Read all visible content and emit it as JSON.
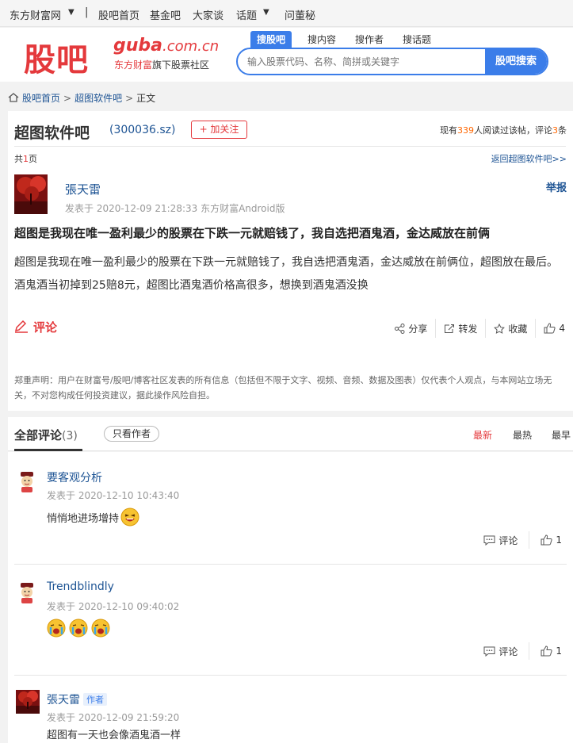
{
  "topbar": {
    "site": "东方财富网",
    "links": [
      "股吧首页",
      "基金吧",
      "大家谈",
      "话题",
      "问董秘"
    ]
  },
  "header": {
    "logo_cn": "股吧",
    "logo_en_main": "guba",
    "logo_en_domain": ".com.cn",
    "logo_sub_brand": "东方财富",
    "logo_sub_rest": "旗下股票社区",
    "search_tabs": [
      "搜股吧",
      "搜内容",
      "搜作者",
      "搜话题"
    ],
    "search_placeholder": "输入股票代码、名称、简拼或关键字",
    "search_button": "股吧搜索"
  },
  "breadcrumb": {
    "home": "股吧首页",
    "bar": "超图软件吧",
    "current": "正文"
  },
  "bar": {
    "name": "超图软件吧",
    "code": "(300036.sz)",
    "follow_label": "+ 加关注",
    "stats_prefix": "现有",
    "readers": "339",
    "stats_mid": "人阅读过该帖，评论",
    "comments": "3",
    "stats_suffix": "条"
  },
  "pagination": {
    "prefix": "共",
    "pages": "1",
    "suffix": "页",
    "back": "返回超图软件吧>>"
  },
  "post": {
    "author": "張天雷",
    "report": "举报",
    "meta": "发表于 2020-12-09 21:28:33 东方财富Android版",
    "title": "超图是我现在唯一盈利最少的股票在下跌一元就赔钱了，我自选把酒鬼酒，金达威放在前俩",
    "body": "超图是我现在唯一盈利最少的股票在下跌一元就赔钱了，我自选把酒鬼酒，金达威放在前俩位，超图放在最后。酒鬼酒当初掉到25赔8元，超图比酒鬼酒价格高很多，想换到酒鬼酒没换",
    "comment_label": "评论",
    "actions": {
      "share": "分享",
      "forward": "转发",
      "favorite": "收藏",
      "likes": "4"
    },
    "disclaimer": "郑重声明：用户在财富号/股吧/博客社区发表的所有信息（包括但不限于文字、视频、音频、数据及图表）仅代表个人观点，与本网站立场无关，不对您构成任何投资建议，据此操作风险自担。"
  },
  "comments_header": {
    "title": "全部评论",
    "count": "(3)",
    "only_author": "只看作者",
    "sort": [
      "最新",
      "最热",
      "最早"
    ]
  },
  "comments": [
    {
      "user": "要客观分析",
      "time": "发表于 2020-12-10 10:43:40",
      "text": "悄悄地进场增持",
      "reply_label": "评论",
      "likes": "1"
    },
    {
      "user": "Trendblindly",
      "time": "发表于 2020-12-10 09:40:02",
      "text": "",
      "reply_label": "评论",
      "likes": "1"
    },
    {
      "user": "張天雷",
      "tag": "作者",
      "time": "发表于 2020-12-09 21:59:20",
      "text": "超图有一天也会像酒鬼酒一样"
    }
  ],
  "colors": {
    "brand_red": "#e4393c",
    "link_blue": "#1e5494",
    "accent_blue": "#3b7de9",
    "highlight_orange": "#ff6600"
  }
}
